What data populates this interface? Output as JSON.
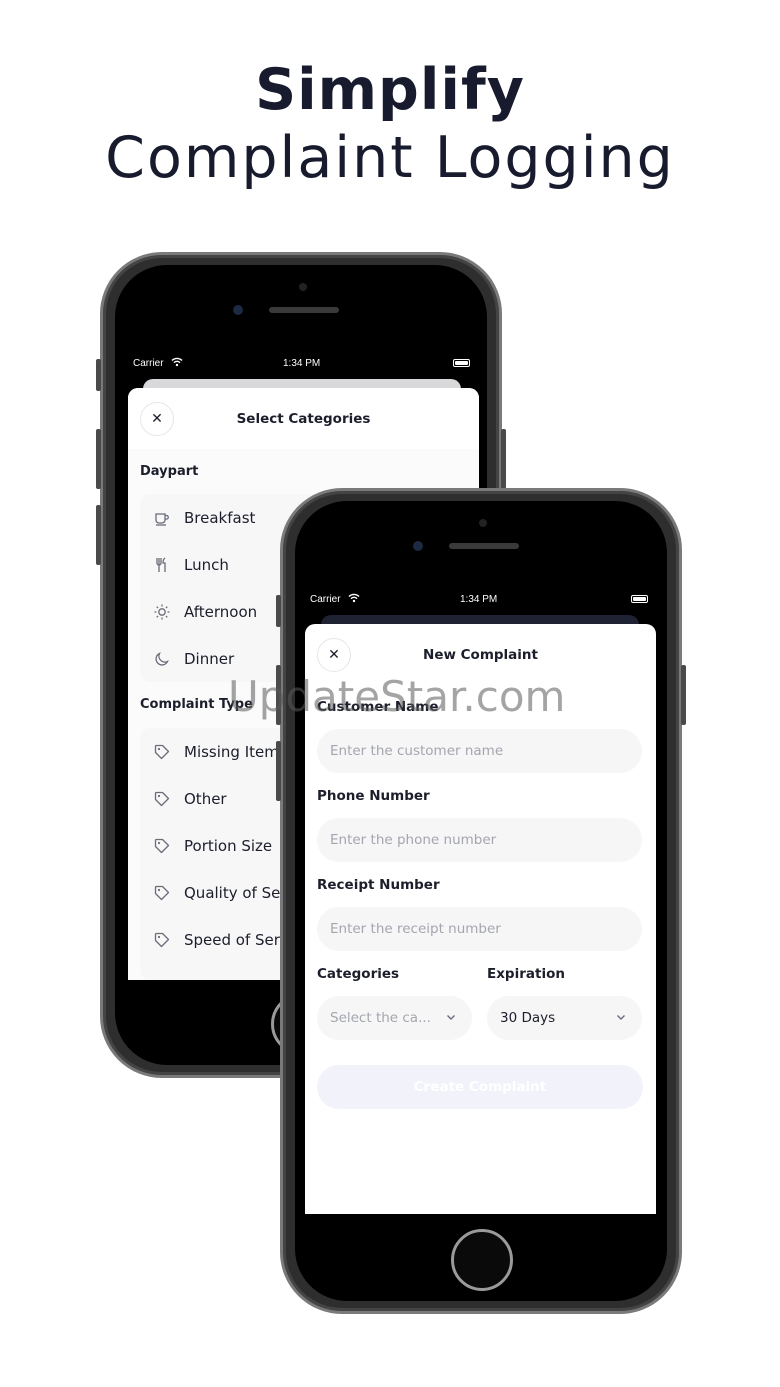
{
  "headline": {
    "line1": "Simplify",
    "line2": "Complaint Logging"
  },
  "status_bar": {
    "carrier": "Carrier",
    "time": "1:34 PM"
  },
  "select_categories": {
    "title": "Select Categories",
    "close_glyph": "✕",
    "daypart_label": "Daypart",
    "daypart_items": [
      {
        "label": "Breakfast",
        "icon": "coffee-cup-icon"
      },
      {
        "label": "Lunch",
        "icon": "fork-knife-icon"
      },
      {
        "label": "Afternoon",
        "icon": "sun-icon"
      },
      {
        "label": "Dinner",
        "icon": "moon-icon"
      }
    ],
    "complaint_type_label": "Complaint Type",
    "complaint_type_items": [
      {
        "label": "Missing Item",
        "icon": "tag-icon"
      },
      {
        "label": "Other",
        "icon": "tag-icon"
      },
      {
        "label": "Portion Size",
        "icon": "tag-icon"
      },
      {
        "label": "Quality of Service",
        "icon": "tag-icon"
      },
      {
        "label": "Speed of Service",
        "icon": "tag-icon"
      }
    ]
  },
  "new_complaint": {
    "title": "New Complaint",
    "close_glyph": "✕",
    "customer_name_label": "Customer Name",
    "customer_name_placeholder": "Enter the customer name",
    "phone_label": "Phone Number",
    "phone_placeholder": "Enter the phone number",
    "receipt_label": "Receipt Number",
    "receipt_placeholder": "Enter the receipt number",
    "categories_label": "Categories",
    "categories_placeholder": "Select the ca...",
    "expiration_label": "Expiration",
    "expiration_value": "30 Days",
    "create_button": "Create Complaint"
  },
  "watermark": "UpdateStar.com",
  "colors": {
    "headline": "#171b2d",
    "text": "#1c1e2b",
    "placeholder": "#a4a6ae",
    "field_bg": "#f6f6f7",
    "button_disabled": "#f2f2fb"
  }
}
